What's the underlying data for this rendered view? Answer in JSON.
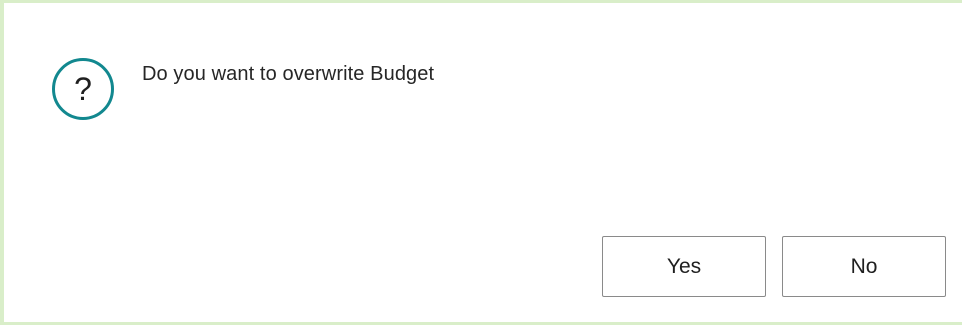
{
  "dialog": {
    "icon": "question-circle-icon",
    "message": "Do you want to overwrite Budget",
    "accent_color": "#12888f",
    "buttons": {
      "yes_label": "Yes",
      "no_label": "No"
    }
  }
}
